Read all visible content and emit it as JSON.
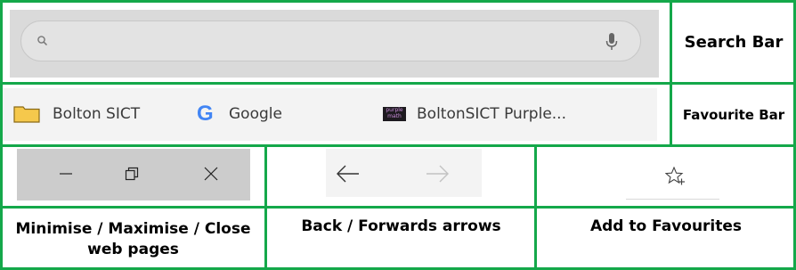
{
  "labels": {
    "search_bar": "Search Bar",
    "favourite_bar": "Favourite Bar",
    "window_controls": "Minimise / Maximise / Close web pages",
    "nav_arrows": "Back  / Forwards arrows",
    "add_favourites": "Add to Favourites"
  },
  "favourites": [
    {
      "label": "Bolton SICT",
      "icon": "folder-icon"
    },
    {
      "label": "Google",
      "icon": "google-icon",
      "glyph": "G"
    },
    {
      "label": "BoltonSICT Purple...",
      "icon": "purple-math-icon",
      "glyph": "purple math"
    }
  ],
  "colors": {
    "grid": "#14a84a",
    "folder": "#f5c84c"
  }
}
